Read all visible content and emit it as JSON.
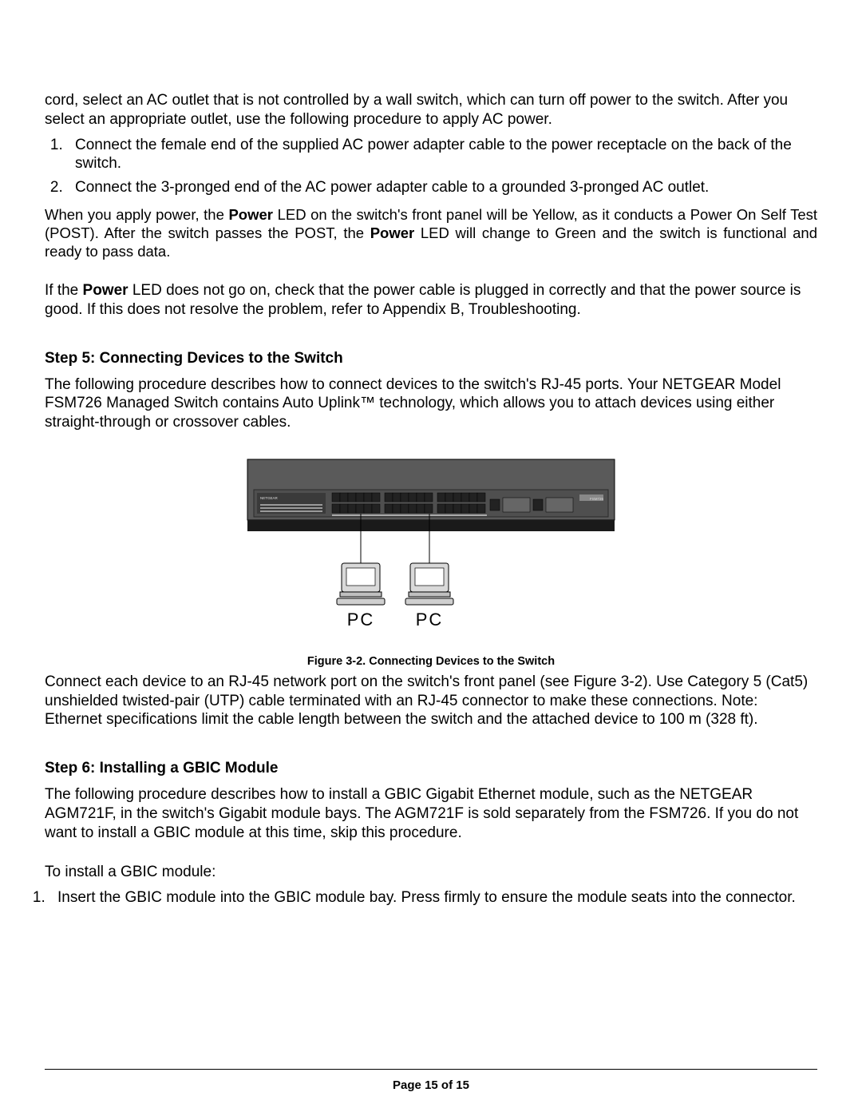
{
  "para_top": "cord, select an AC outlet that is not controlled by a wall switch, which can turn off power to the switch. After you select an appropriate outlet, use the following procedure to apply AC power.",
  "ol1": [
    "Connect the female end of the supplied AC power adapter cable to the power receptacle on the back of the switch.",
    "Connect the 3-pronged end of the AC power adapter cable to a grounded 3-pronged AC outlet."
  ],
  "post_power": {
    "pre1": "When you apply power, the ",
    "b1": "Power",
    "mid1": " LED on the switch's front panel will be Yellow, as it conducts a Power On Self Test (POST).  After the switch passes the POST, the ",
    "b2": "Power",
    "post1": " LED will change to Green and the switch is functional and ready to pass data."
  },
  "para_if": {
    "pre": "If the ",
    "b": "Power",
    "post": " LED does not go on, check that the power cable is plugged in correctly and that the power source is good. If this does not resolve the problem, refer to Appendix B, Troubleshooting."
  },
  "step5_heading": "Step 5: Connecting Devices to the Switch",
  "step5_para": "The following procedure describes how to connect devices to the switch's RJ-45 ports. Your NETGEAR Model FSM726 Managed Switch contains Auto Uplink™ technology, which allows you to attach devices using either straight-through or crossover cables.",
  "figure": {
    "pc_labels": [
      "PC",
      "PC"
    ],
    "caption": "Figure 3-2. Connecting Devices to the Switch",
    "brand": "NETGEAR",
    "model": "FSM726"
  },
  "step5_after": "Connect each device to an RJ-45 network port on the switch's front panel (see Figure 3-2). Use Category 5 (Cat5) unshielded twisted-pair (UTP) cable terminated with an RJ-45 connector to make these connections. Note: Ethernet specifications limit the cable length between the switch and the attached device to 100 m (328 ft).",
  "step6_heading": "Step 6: Installing a GBIC Module",
  "step6_para": "The following procedure describes how to install a GBIC Gigabit Ethernet module, such as the NETGEAR AGM721F, in the switch's Gigabit module bays. The AGM721F is sold separately from the FSM726.  If you do not want to install a GBIC module at this time, skip this procedure.",
  "step6_lead": "To install a GBIC module:",
  "ol2": [
    "Insert the GBIC module into the GBIC module bay.  Press firmly to ensure the module seats into the connector."
  ],
  "pagenum": "Page 15 of 15"
}
